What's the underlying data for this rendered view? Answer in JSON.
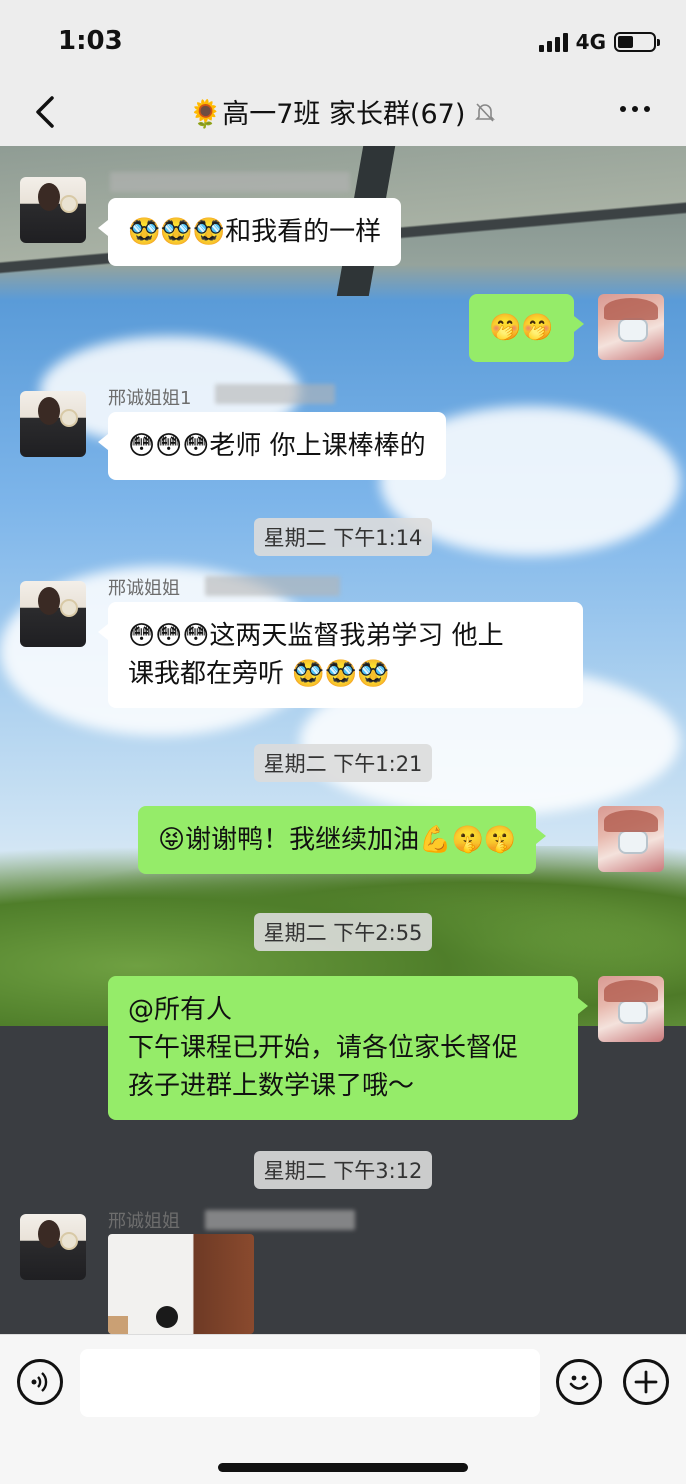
{
  "status": {
    "time": "1:03",
    "network": "4G",
    "battery_level": 0.45
  },
  "nav": {
    "back_label": "‹",
    "title": "🌻高一7班 家长群(67)",
    "more_label": "···"
  },
  "messages": {
    "m1": {
      "text": "🥸🥸🥸和我看的一样"
    },
    "m2": {
      "text": "🤭🤭"
    },
    "m3": {
      "sender": "邢诚姐姐1",
      "text": "😳😳😳老师  你上课棒棒的"
    },
    "ts1": "星期二 下午1:14",
    "m4": {
      "sender": "邢诚姐姐",
      "line1": "😳😳😳这两天监督我弟学习  他上",
      "line2": "课我都在旁听  🥸🥸🥸"
    },
    "ts2": "星期二 下午1:21",
    "m5": {
      "text": "😝谢谢鸭！我继续加油💪🤫🤫"
    },
    "ts3": "星期二 下午2:55",
    "m6": {
      "line1": "@所有人",
      "line2": "下午课程已开始，请各位家长督促",
      "line3": "孩子进群上数学课了哦～"
    },
    "ts4": "星期二 下午3:12",
    "m7": {
      "sender": "邢诚姐姐"
    }
  },
  "icons": {
    "voice": "voice-icon",
    "emoji": "emoji-icon",
    "plus": "plus-icon",
    "mute": "mute-bell-icon"
  }
}
